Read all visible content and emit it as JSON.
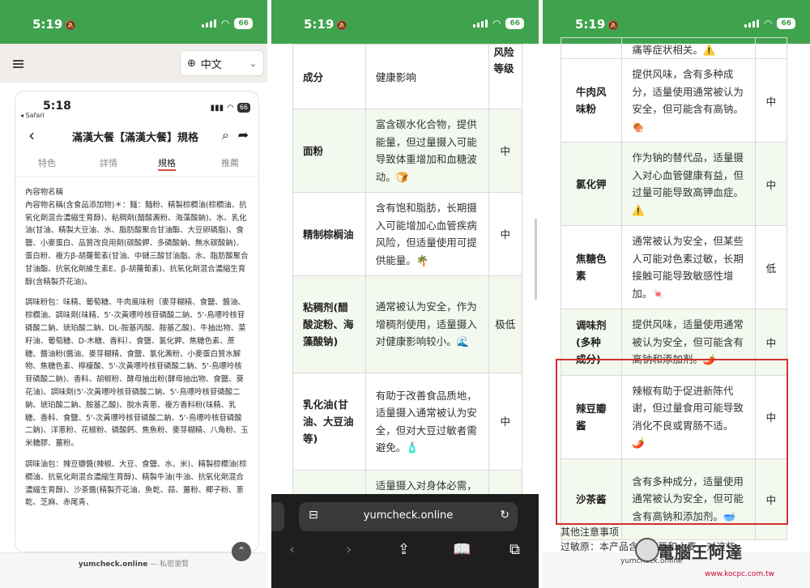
{
  "status": {
    "time": "5:19",
    "battery": "66"
  },
  "panel1": {
    "language": "中文",
    "inner": {
      "time": "5:18",
      "back_app": "◂ Safari",
      "battery": "66",
      "title": "滿漢大餐【滿漢大餐】規格",
      "tabs": [
        "特色",
        "詳情",
        "規格",
        "推薦"
      ],
      "active_tab": "規格",
      "paragraphs": [
        "內容物名稱",
        "內容物名稱(含食品添加物)＊：麵：麵粉、精製棕櫚油(棕櫚油、抗氧化劑混合濃縮生育醇)、粘稠劑(醋酸澱粉、海藻酸鈉)、水、乳化油(甘油、精製大豆油、水、脂肪酸聚合甘油酯、大豆卵磷脂)、食鹽、小麥蛋白、品質改良用劑(碳酸鉀、多磷酸鈉、無水碳酸鈉)、蛋白粉、複方β-胡蘿蔔素(甘油、中鏈三酸甘油脂、水、脂肪酸聚合甘油酯、抗氧化劑維生素E、β-胡蘿蔔素)、抗氧化劑混合濃縮生育醇(含精製芥花油)。",
        "調味粉包：味精、葡萄糖、牛肉風味粉〔麥芽糊精、食鹽、醬油、棕櫚油、調味劑(味精、5'-次黃嘌呤核苷磷酸二鈉、5'-鳥嘌呤核苷磷酸二鈉、琥珀酸二鈉、DL-胺基丙酸、胺基乙酸)、牛抽出物、菜籽油、葡萄糖、D-木糖、香料〕、食鹽、氯化鉀、焦糖色素、蔗糖、醬油粉(醬油、麥芽糊精、食鹽、氯化澱粉、小麥蛋白質水解物、焦糖色素、檸檬酸、5'-次黃嘌呤核苷磷酸二鈉、5'-鳥嘌呤核苷磷酸二鈉)、香料、胡椒粉、酵母抽出粉(酵母抽出物、食鹽、葵花油)、調味劑(5'-次黃嘌呤核苷磷酸二鈉、5'-鳥嘌呤核苷磷酸二鈉、琥珀酸二鈉、胺基乙酸)、脫水青蔥、複方香料粉(味精、乳糖、香料、食鹽、5'-次黃嘌呤核苷磷酸二鈉、5'-鳥嘌呤核苷磷酸二鈉)、洋蔥粉、花椒粉、磷酸鈣、焦魚粉、麥芽糊精、八角粉、玉米糖膠、薑粉。",
        "調味油包：辣豆瓣醬(辣椒、大豆、食鹽、水、米)、精製棕櫚油(棕櫚油、抗氧化劑混合濃縮生育醇)、精製牛油(牛油、抗氧化劑混合濃縮生育醇)、沙茶醬(精製芥花油、魚乾、蒜、薑粉、椰子粉、蔥乾、芝麻、赤尾青、"
      ],
      "url": "yumcheck.online",
      "url_suffix": "— 私密瀏覽"
    }
  },
  "panel2": {
    "headers": [
      "成分",
      "健康影响",
      "风险等级"
    ],
    "rows": [
      {
        "name": "面粉",
        "effect": "富含碳水化合物，提供能量，但过量摄入可能导致体重增加和血糖波动。🍞",
        "risk": "中"
      },
      {
        "name": "精制棕榈油",
        "effect": "含有饱和脂肪，长期摄入可能增加心血管疾病风险，但适量使用可提供能量。🌴",
        "risk": "中"
      },
      {
        "name": "粘稠剂(醋酸淀粉、海藻酸钠)",
        "effect": "通常被认为安全，作为增稠剂使用，适量摄入对健康影响较小。🌊",
        "risk": "极低"
      },
      {
        "name": "乳化油(甘油、大豆油等)",
        "effect": "有助于改善食品质地，适量摄入通常被认为安全，但对大豆过敏者需避免。🧴",
        "risk": "中"
      },
      {
        "name": "食盐",
        "effect": "适量摄入对身体必需，但过量摄入可能导致高",
        "risk": "中"
      }
    ],
    "address": "yumcheck.online"
  },
  "panel3": {
    "top_fragment": "痛等症状相关。⚠️",
    "rows": [
      {
        "name": "牛肉风味粉",
        "effect": "提供风味，含有多种成分，适量使用通常被认为安全，但可能含有高钠。🍖",
        "risk": "中"
      },
      {
        "name": "氯化钾",
        "effect": "作为钠的替代品，适量摄入对心血管健康有益，但过量可能导致高钾血症。⚠️",
        "risk": "中"
      },
      {
        "name": "焦糖色素",
        "effect": "通常被认为安全，但某些人可能对色素过敏，长期接触可能导致敏感性增加。🍬",
        "risk": "低"
      },
      {
        "name": "调味剂(多种成分)",
        "effect": "提供风味，适量使用通常被认为安全，但可能含有高钠和添加剂。🌶️",
        "risk": "中"
      },
      {
        "name": "辣豆瓣酱",
        "effect": "辣椒有助于促进新陈代谢，但过量食用可能导致消化不良或胃肠不适。🌶️",
        "risk": "中"
      },
      {
        "name": "沙茶酱",
        "effect": "含有多种成分，适量使用通常被认为安全，但可能含有高钠和添加剂。🥣",
        "risk": "中"
      }
    ],
    "notes_title": "其他注意事项",
    "notes_line": "过敏原：本产品含有大豆和小麦，对这些",
    "watermark": "電腦王阿達",
    "watermark_url": "www.kocpc.com.tw",
    "bottom_url": "yumcheck.online"
  }
}
